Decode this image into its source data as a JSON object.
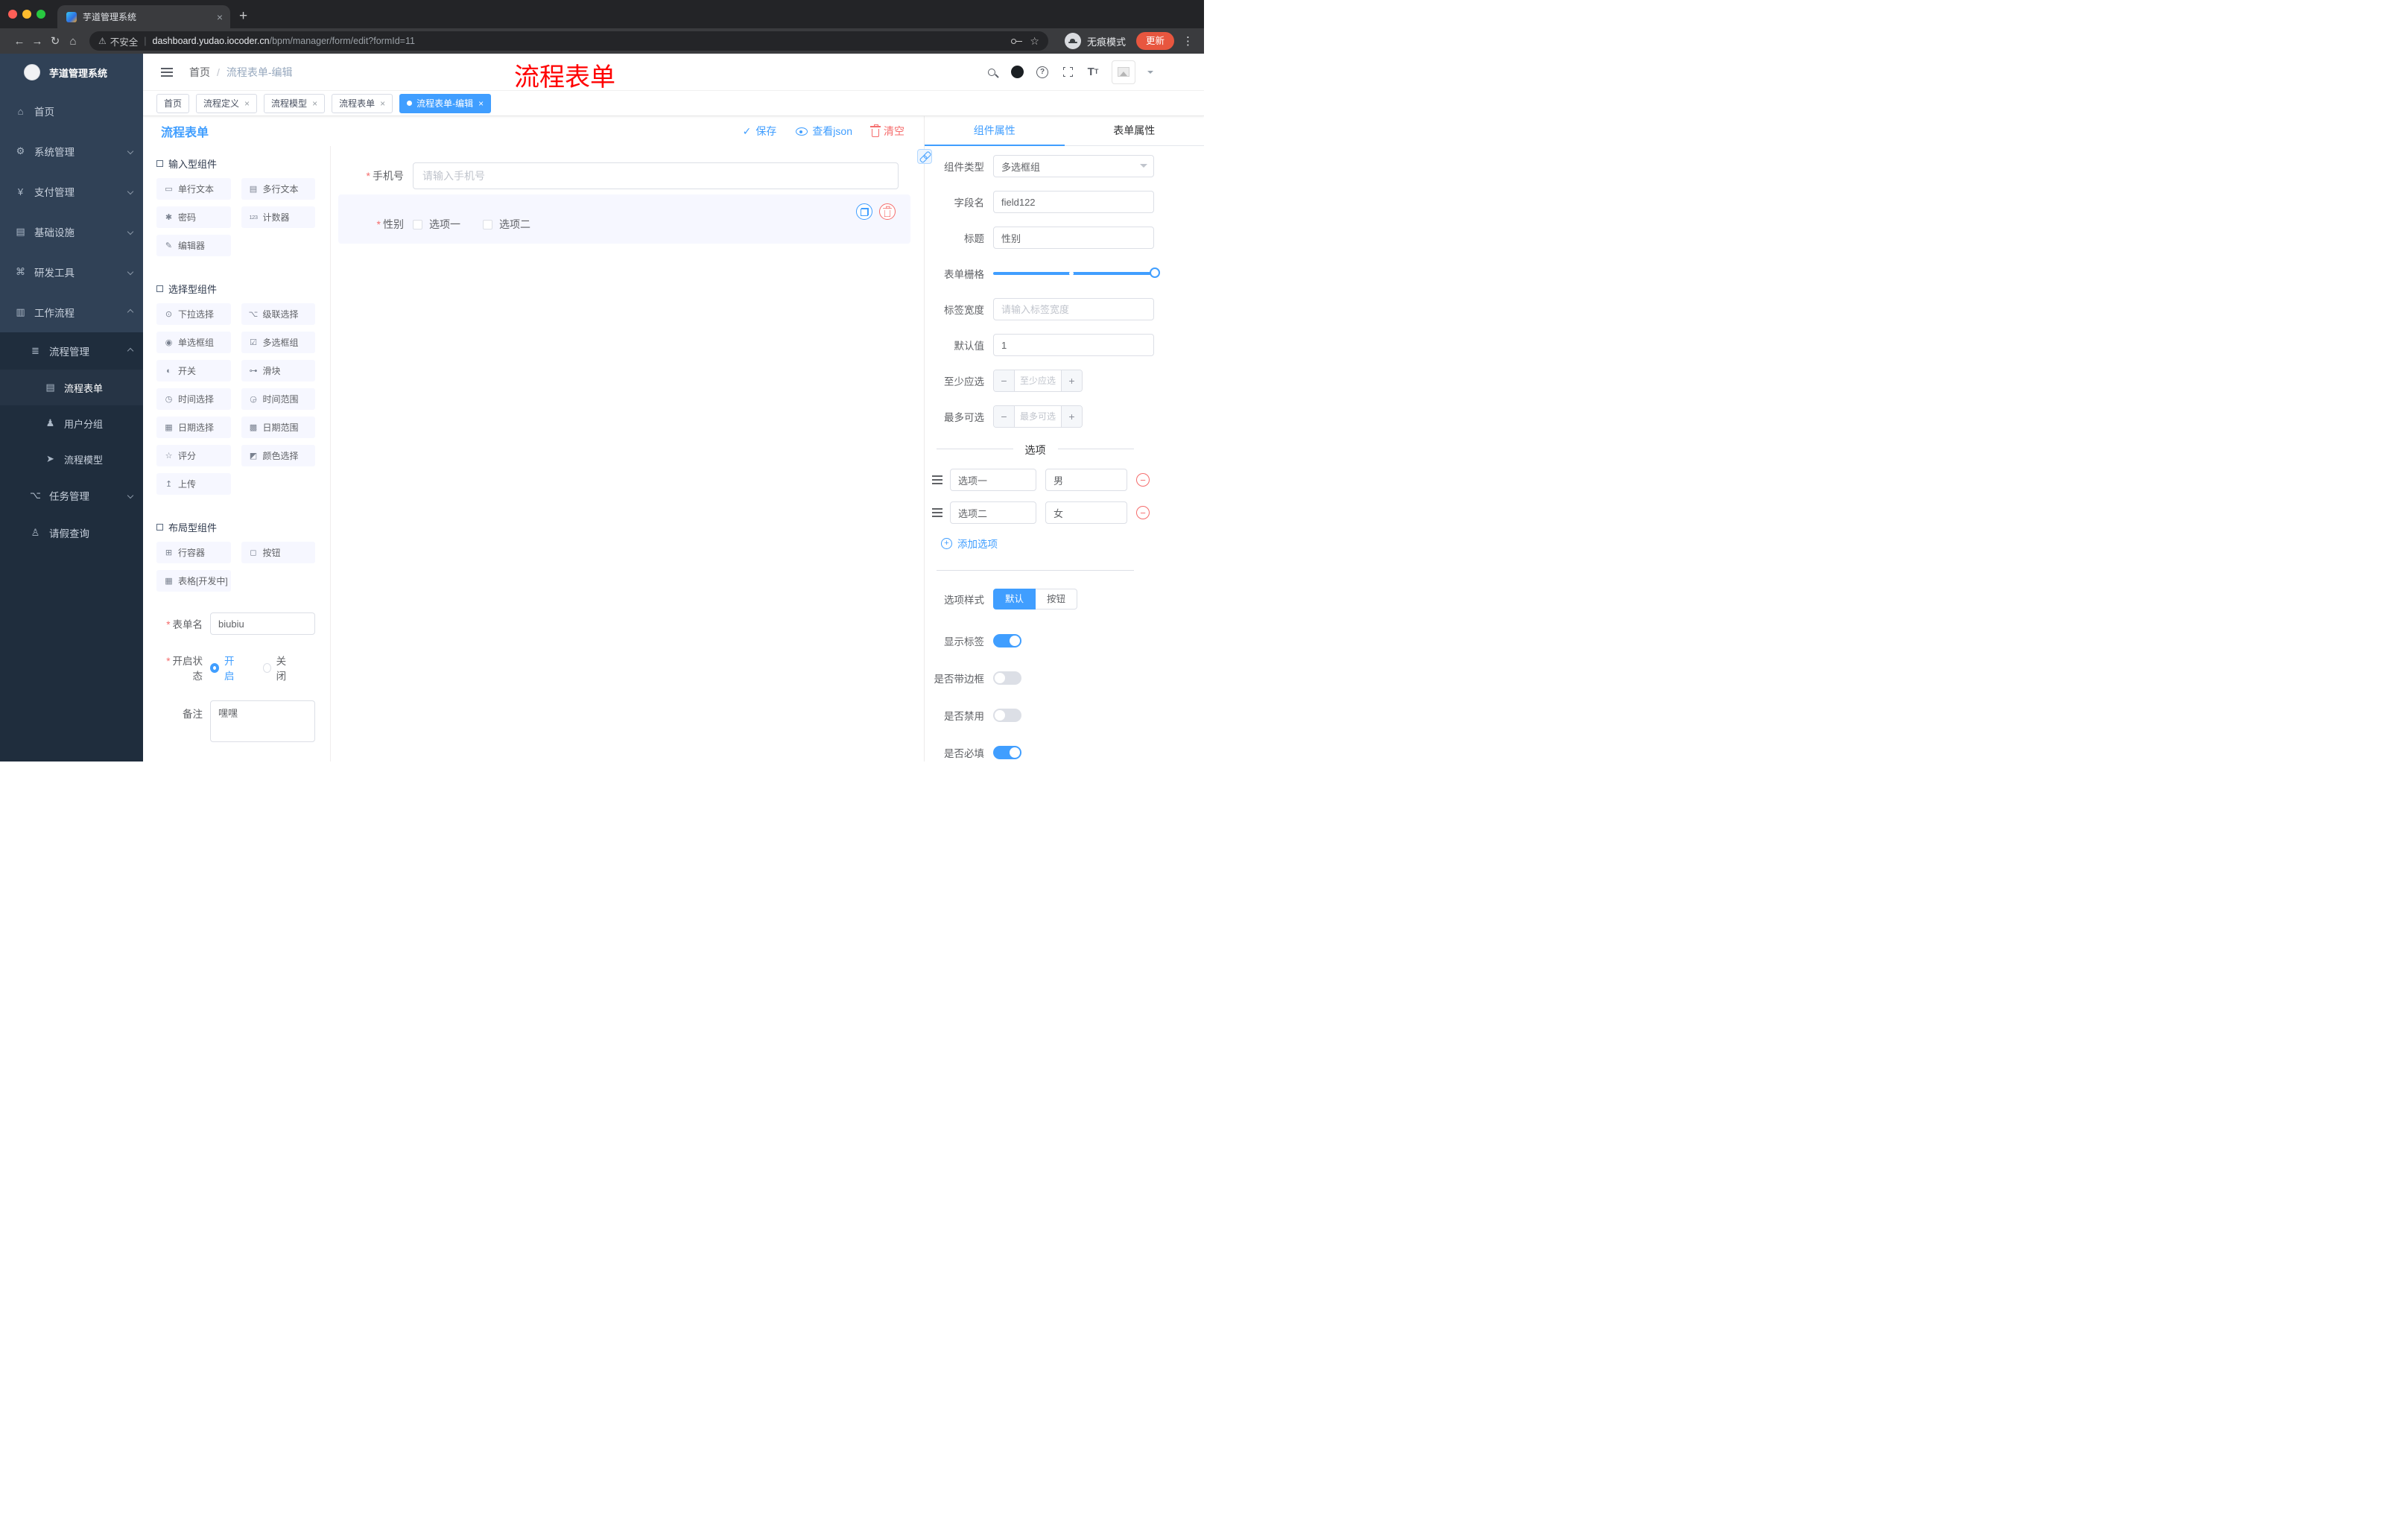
{
  "colors": {
    "accent": "#409eff",
    "danger": "#f56c6c",
    "overlay_red": "#ff0000",
    "sidebar_bg": "#304156",
    "submenu_bg": "#1f2d3d"
  },
  "browser": {
    "tab_title": "芋道管理系统",
    "icons": {
      "back": "←",
      "forward": "→",
      "reload": "↻",
      "home": "⌂",
      "star": "☆",
      "kebab": "⋮",
      "new_tab": "+",
      "close_tab": "×",
      "warning": "⚠"
    },
    "security_label": "不安全",
    "security_sep": "|",
    "url_host": "dashboard.yudao.iocoder.cn",
    "url_path": "/bpm/manager/form/edit?formId=11",
    "incognito_label": "无痕模式",
    "update_label": "更新"
  },
  "sidebar": {
    "logo_title": "芋道管理系统",
    "items": [
      {
        "label": "首页",
        "icon": "⌂"
      },
      {
        "label": "系统管理",
        "icon": "⚙"
      },
      {
        "label": "支付管理",
        "icon": "¥"
      },
      {
        "label": "基础设施",
        "icon": "▤"
      },
      {
        "label": "研发工具",
        "icon": "⌘"
      },
      {
        "label": "工作流程",
        "icon": "▥"
      }
    ],
    "process_group": {
      "label": "流程管理",
      "icon": "≣"
    },
    "process_children": [
      {
        "label": "流程表单",
        "icon": "▤"
      },
      {
        "label": "用户分组",
        "icon": "♟"
      },
      {
        "label": "流程模型",
        "icon": "➤"
      }
    ],
    "task_group": {
      "label": "任务管理",
      "icon": "⌥"
    },
    "leave_item": {
      "label": "请假查询",
      "icon": "♙"
    }
  },
  "header": {
    "breadcrumb_root": "首页",
    "breadcrumb_sep": "/",
    "breadcrumb_current": "流程表单-编辑",
    "overlay_text": "流程表单"
  },
  "tags": {
    "close_icon": "×",
    "items": [
      "首页",
      "流程定义",
      "流程模型",
      "流程表单",
      "流程表单-编辑"
    ]
  },
  "designer": {
    "title": "流程表单",
    "actions": {
      "save_icon": "✓",
      "save": "保存",
      "view_json": "查看json",
      "clear": "清空"
    },
    "groups": {
      "input": {
        "title": "输入型组件",
        "items": [
          {
            "label": "单行文本",
            "icon": "▭"
          },
          {
            "label": "多行文本",
            "icon": "▤"
          },
          {
            "label": "密码",
            "icon": "✱"
          },
          {
            "label": "计数器",
            "icon": "123"
          },
          {
            "label": "编辑器",
            "icon": "✎"
          }
        ]
      },
      "select": {
        "title": "选择型组件",
        "items": [
          {
            "label": "下拉选择",
            "icon": "⊙"
          },
          {
            "label": "级联选择",
            "icon": "⌥"
          },
          {
            "label": "单选框组",
            "icon": "◉"
          },
          {
            "label": "多选框组",
            "icon": "☑"
          },
          {
            "label": "开关",
            "icon": "◐"
          },
          {
            "label": "滑块",
            "icon": "⊶"
          },
          {
            "label": "时间选择",
            "icon": "◷"
          },
          {
            "label": "时间范围",
            "icon": "◶"
          },
          {
            "label": "日期选择",
            "icon": "▦"
          },
          {
            "label": "日期范围",
            "icon": "▩"
          },
          {
            "label": "评分",
            "icon": "☆"
          },
          {
            "label": "颜色选择",
            "icon": "◩"
          },
          {
            "label": "上传",
            "icon": "↥"
          }
        ]
      },
      "layout": {
        "title": "布局型组件",
        "items": [
          {
            "label": "行容器",
            "icon": "⊞"
          },
          {
            "label": "按钮",
            "icon": "◻"
          },
          {
            "label": "表格[开发中]",
            "icon": "▦"
          }
        ]
      }
    },
    "meta": {
      "name_label": "表单名",
      "name_value": "biubiu",
      "status_label": "开启状态",
      "status_on": "开启",
      "status_off": "关闭",
      "remark_label": "备注",
      "remark_value": "嘿嘿"
    },
    "canvas": {
      "phone_label": "手机号",
      "phone_placeholder": "请输入手机号",
      "gender_label": "性别",
      "gender_options": [
        "选项一",
        "选项二"
      ]
    }
  },
  "props": {
    "tab_component": "组件属性",
    "tab_form": "表单属性",
    "type_label": "组件类型",
    "type_value": "多选框组",
    "field_label": "字段名",
    "field_value": "field122",
    "title_label": "标题",
    "title_value": "性别",
    "grid_label": "表单栅格",
    "width_label": "标签宽度",
    "width_placeholder": "请输入标签宽度",
    "default_label": "默认值",
    "default_value": "1",
    "min_label": "至少应选",
    "min_placeholder": "至少应选",
    "max_label": "最多可选",
    "max_placeholder": "最多可选",
    "options_title": "选项",
    "options": [
      {
        "label": "选项一",
        "value": "男"
      },
      {
        "label": "选项二",
        "value": "女"
      }
    ],
    "add_option": "添加选项",
    "style_label": "选项样式",
    "style_default": "默认",
    "style_button": "按钮",
    "switch_show_label": "显示标签",
    "switch_border": "是否带边框",
    "switch_disabled": "是否禁用",
    "switch_required": "是否必填"
  }
}
